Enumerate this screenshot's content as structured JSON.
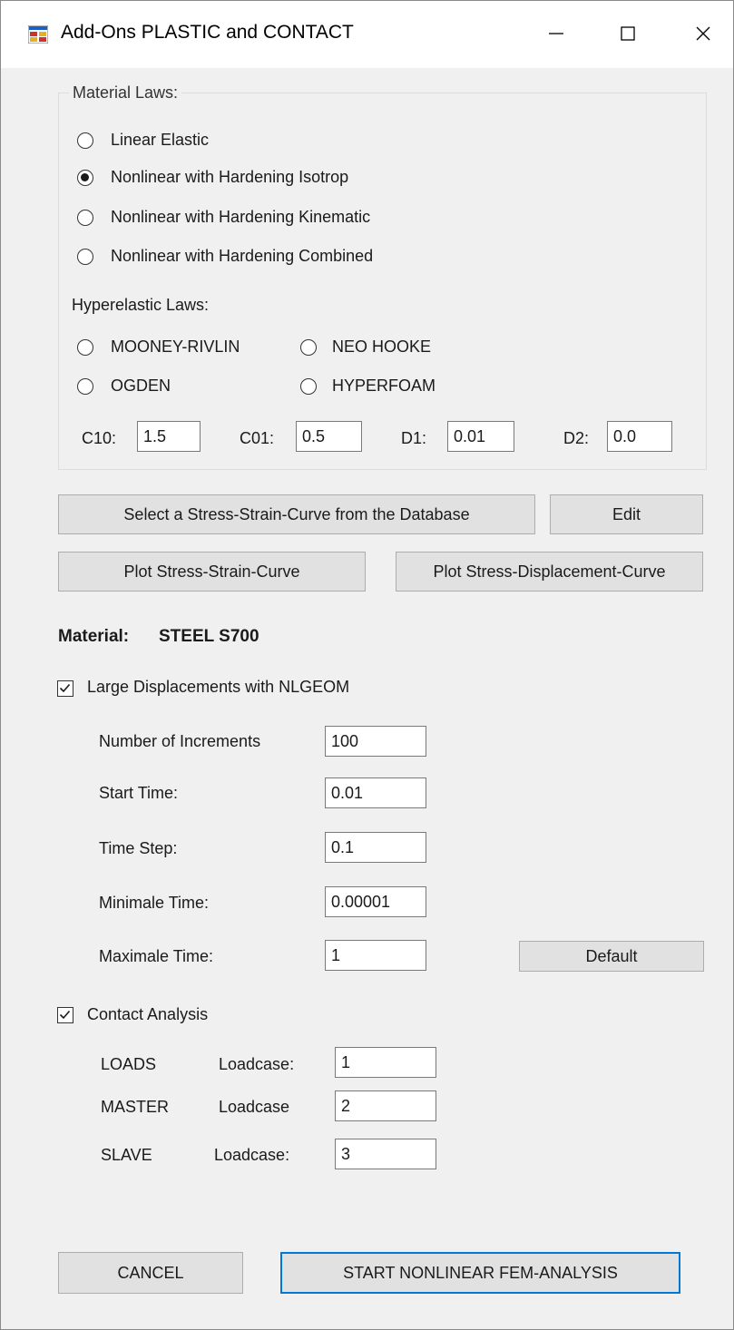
{
  "window": {
    "title": "Add-Ons PLASTIC and CONTACT",
    "minimize": "—",
    "maximize": "☐",
    "close": "✕"
  },
  "material_laws": {
    "group_label": "Material Laws:",
    "options": [
      {
        "label": "Linear Elastic",
        "checked": false
      },
      {
        "label": "Nonlinear with Hardening Isotrop",
        "checked": true
      },
      {
        "label": "Nonlinear with Hardening Kinematic",
        "checked": false
      },
      {
        "label": "Nonlinear with Hardening Combined",
        "checked": false
      }
    ]
  },
  "hyperelastic": {
    "label": "Hyperelastic Laws:",
    "options": [
      {
        "label": "MOONEY-RIVLIN",
        "checked": false
      },
      {
        "label": "NEO HOOKE",
        "checked": false
      },
      {
        "label": "OGDEN",
        "checked": false
      },
      {
        "label": "HYPERFOAM",
        "checked": false
      }
    ],
    "params": [
      {
        "label": "C10:",
        "value": "1.5"
      },
      {
        "label": "C01:",
        "value": "0.5"
      },
      {
        "label": "D1:",
        "value": "0.01"
      },
      {
        "label": "D2:",
        "value": "0.0"
      }
    ]
  },
  "buttons": {
    "select_curve": "Select a Stress-Strain-Curve from the Database",
    "edit": "Edit",
    "plot_strain": "Plot Stress-Strain-Curve",
    "plot_displacement": "Plot Stress-Displacement-Curve",
    "default": "Default",
    "cancel": "CANCEL",
    "start": "START NONLINEAR FEM-ANALYSIS"
  },
  "material": {
    "label": "Material:",
    "value": "STEEL S700"
  },
  "nlgeom": {
    "label": "Large Displacements with NLGEOM",
    "checked": true,
    "fields": [
      {
        "label": "Number of Increments",
        "value": "100"
      },
      {
        "label": "Start Time:",
        "value": "0.01"
      },
      {
        "label": "Time Step:",
        "value": "0.1"
      },
      {
        "label": "Minimale Time:",
        "value": "0.00001"
      },
      {
        "label": "Maximale Time:",
        "value": "1"
      }
    ]
  },
  "contact": {
    "label": "Contact Analysis",
    "checked": true,
    "rows": [
      {
        "name": "LOADS",
        "label": "Loadcase:",
        "value": "1"
      },
      {
        "name": "MASTER",
        "label": "Loadcase",
        "value": "2"
      },
      {
        "name": "SLAVE",
        "label": "Loadcase:",
        "value": "3"
      }
    ]
  },
  "colors": {
    "accent": "#0078d7",
    "background": "#f0f0f0",
    "button": "#e1e1e1"
  }
}
